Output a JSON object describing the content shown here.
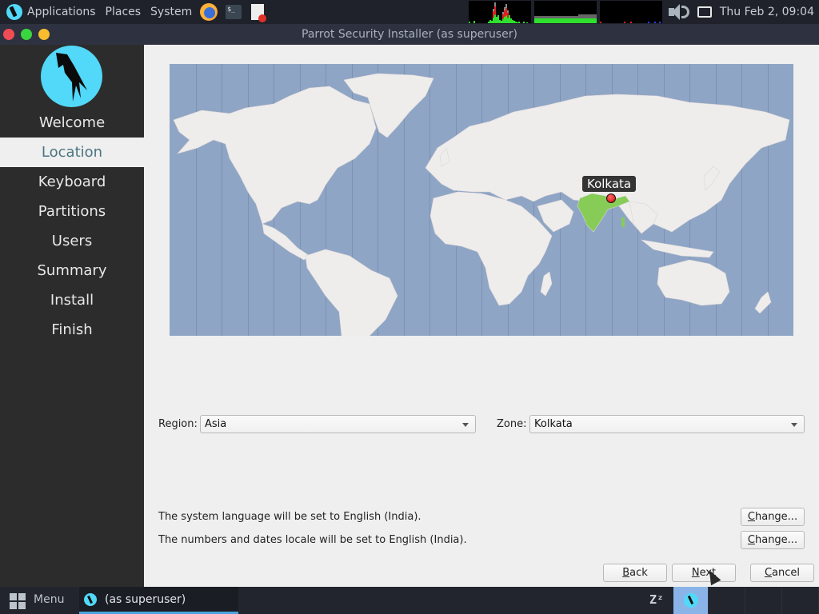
{
  "top_panel": {
    "menus": [
      "Applications",
      "Places",
      "System"
    ],
    "launchers": [
      "firefox",
      "terminal",
      "text-editor"
    ],
    "terminal_glyph": "$_",
    "clock": "Thu Feb  2, 09:04"
  },
  "window": {
    "title": "Parrot Security Installer (as superuser)"
  },
  "sidebar": {
    "steps": [
      {
        "label": "Welcome",
        "active": false
      },
      {
        "label": "Location",
        "active": true
      },
      {
        "label": "Keyboard",
        "active": false
      },
      {
        "label": "Partitions",
        "active": false
      },
      {
        "label": "Users",
        "active": false
      },
      {
        "label": "Summary",
        "active": false
      },
      {
        "label": "Install",
        "active": false
      },
      {
        "label": "Finish",
        "active": false
      }
    ]
  },
  "map": {
    "selected_city": "Kolkata",
    "colors": {
      "ocean": "#8fa5c5",
      "land": "#efecec",
      "highlight": "#86cc56",
      "marker": "#d80000"
    }
  },
  "form": {
    "region_label": "Region:",
    "region_value": "Asia",
    "zone_label": "Zone:",
    "zone_value": "Kolkata"
  },
  "locale": {
    "language_text": "The system language will be set to English (India).",
    "numbers_text": "The numbers and dates locale will be set to English (India).",
    "change_label_accel": "C",
    "change_label_rest": "hange..."
  },
  "buttons": {
    "back": {
      "accel": "B",
      "rest": "ack"
    },
    "next": {
      "accel": "N",
      "rest": "ext"
    },
    "cancel": {
      "accel": "C",
      "rest": "ancel"
    }
  },
  "taskbar": {
    "menu_label": "Menu",
    "task_label": "(as superuser)",
    "sleep_glyph": "Zᶻ"
  }
}
